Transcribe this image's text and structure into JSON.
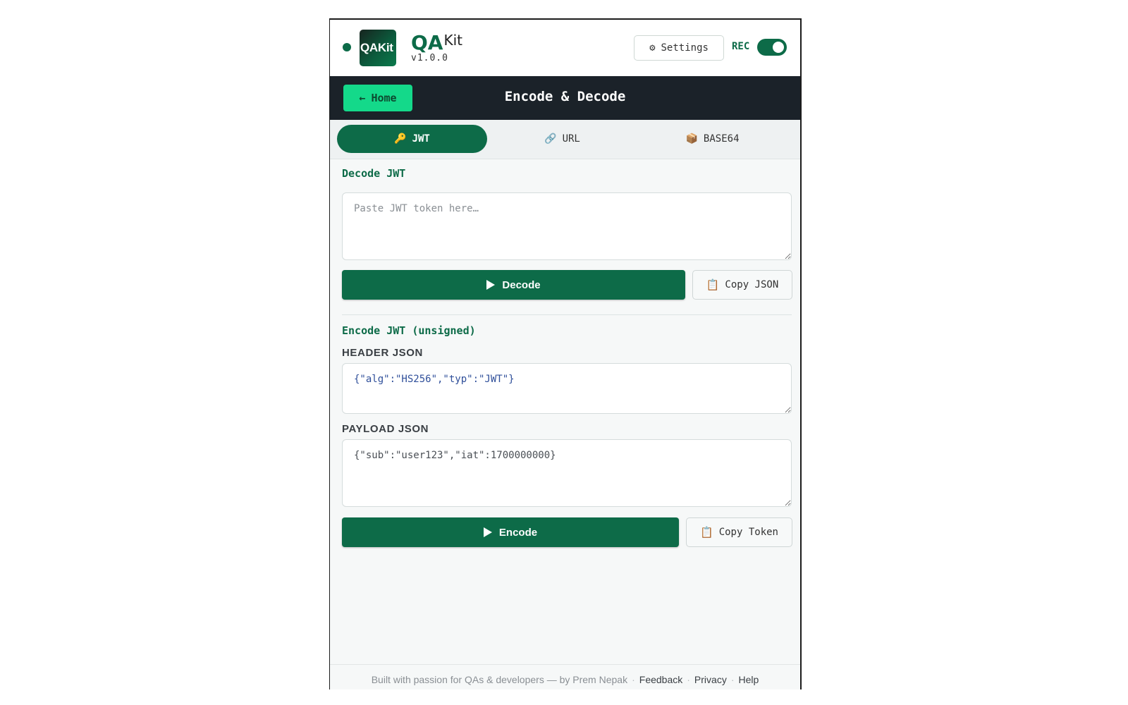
{
  "header": {
    "logo_text": "QAKit",
    "brand_qa": "QA",
    "brand_kit": "Kit",
    "version": "v1.0.0",
    "settings_icon": "⚙",
    "settings_label": "Settings",
    "rec_label": "REC",
    "rec_enabled": true
  },
  "titlebar": {
    "home_icon": "←",
    "home_label": "Home",
    "title": "Encode & Decode"
  },
  "tabs": [
    {
      "icon": "🔑",
      "label": "JWT",
      "active": true
    },
    {
      "icon": "🔗",
      "label": "URL",
      "active": false
    },
    {
      "icon": "📦",
      "label": "BASE64",
      "active": false
    }
  ],
  "decode": {
    "title": "Decode JWT",
    "placeholder": "Paste JWT token here…",
    "value": "",
    "decode_label": "Decode",
    "copy_icon": "📋",
    "copy_label": "Copy JSON"
  },
  "encode": {
    "title": "Encode JWT (unsigned)",
    "header_label": "HEADER JSON",
    "header_value": "{\"alg\":\"HS256\",\"typ\":\"JWT\"}",
    "payload_label": "PAYLOAD JSON",
    "payload_value": "{\"sub\":\"user123\",\"iat\":1700000000}",
    "encode_label": "Encode",
    "copy_icon": "📋",
    "copy_label": "Copy Token"
  },
  "footer": {
    "credit": "Built with passion for QAs & developers — by Prem Nepak",
    "sep": "·",
    "links": [
      "Feedback",
      "Privacy",
      "Help"
    ]
  },
  "colors": {
    "accent": "#0d6b48",
    "home_button": "#14d98a",
    "titlebar": "#1b2229"
  }
}
